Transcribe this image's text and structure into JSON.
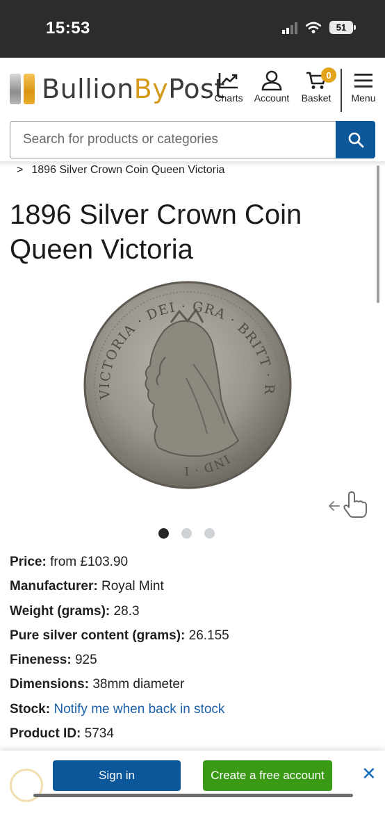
{
  "status_bar": {
    "time": "15:53",
    "battery": "51"
  },
  "header": {
    "logo": {
      "part1": "Bullion",
      "part2": "By",
      "part3": "Post"
    },
    "nav": [
      {
        "label": "Charts",
        "icon": "chart-icon"
      },
      {
        "label": "Account",
        "icon": "user-icon"
      },
      {
        "label": "Basket",
        "icon": "basket-icon",
        "badge": "0"
      },
      {
        "label": "Menu",
        "icon": "menu-icon"
      }
    ]
  },
  "search": {
    "placeholder": "Search for products or categories",
    "icon": "search-icon"
  },
  "breadcrumb": {
    "separator": ">",
    "current": "1896 Silver Crown Coin Queen Victoria"
  },
  "product": {
    "title": "1896 Silver Crown Coin Queen Victoria",
    "coin_legend_top": "VICTORIA · DEI · GRA · BRITT · REGINA · FID · DEF ·",
    "coin_legend_bottom": "IND · IMP ·",
    "gallery": {
      "count": 3,
      "active_index": 0
    },
    "specs": [
      {
        "label": "Price:",
        "value": "from £103.90"
      },
      {
        "label": "Manufacturer:",
        "value": "Royal Mint"
      },
      {
        "label": "Weight (grams):",
        "value": "28.3"
      },
      {
        "label": "Pure silver content (grams):",
        "value": "26.155"
      },
      {
        "label": "Fineness:",
        "value": "925"
      },
      {
        "label": "Dimensions:",
        "value": "38mm diameter"
      },
      {
        "label": "Stock:",
        "value": "Notify me when back in stock",
        "link": true
      },
      {
        "label": "Product ID:",
        "value": "5734"
      }
    ]
  },
  "bottom_bar": {
    "signin_label": "Sign in",
    "create_label": "Create a free account",
    "close_label": "✕"
  },
  "colors": {
    "primary_blue": "#0b5799",
    "green": "#3a9a16",
    "gold": "#e3a41a",
    "link": "#1a5fa8"
  }
}
